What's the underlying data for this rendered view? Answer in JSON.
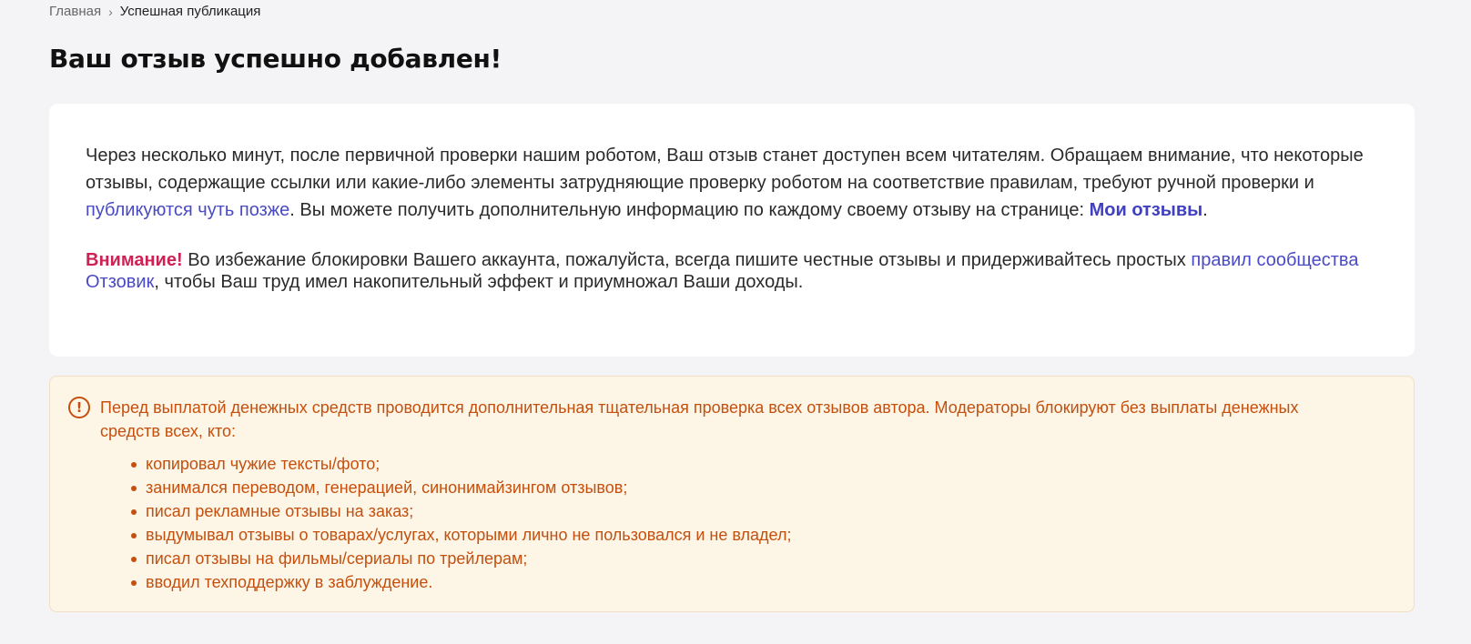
{
  "breadcrumb": {
    "home": "Главная",
    "separator": "›",
    "current": "Успешная публикация"
  },
  "title": "Ваш отзыв успешно добавлен!",
  "intro": {
    "text_before": "Через несколько минут, после первичной проверки нашим роботом, Ваш отзыв станет доступен всем читателям. Обращаем внимание, что некоторые отзывы, содержащие ссылки или какие-либо элементы затрудняющие проверку роботом на соответствие правилам, требуют ручной проверки и ",
    "link_later": "публикуются чуть позже",
    "text_after": ". Вы можете получить дополнительную информацию по каждому своему отзыву на странице: ",
    "link_my_reviews": "Мои отзывы",
    "end": "."
  },
  "warning": {
    "label": "Внимание!",
    "text_before": " Во избежание блокировки Вашего аккаунта, пожалуйста, всегда пишите честные отзывы и придерживайтесь простых ",
    "link_rules": "правил сообщества Отзовик",
    "text_after": ", чтобы Ваш труд имел накопительный эффект и приумножал Ваши доходы."
  },
  "alert": {
    "icon": "exclamation-circle-icon",
    "text": "Перед выплатой денежных средств проводится дополнительная тщательная проверка всех отзывов автора. Модераторы блокируют без выплаты денежных средств всех, кто:",
    "items": [
      "копировал чужие тексты/фото;",
      "занимался переводом, генерацией, синонимайзингом отзывов;",
      "писал рекламные отзывы на заказ;",
      "выдумывал отзывы о товарах/услугах, которыми лично не пользовался и не владел;",
      "писал отзывы на фильмы/сериалы по трейлерам;",
      "вводил техподдержку в заблуждение."
    ]
  },
  "colors": {
    "background": "#f4f4f6",
    "link": "#4a4ac4",
    "attention": "#cc2255",
    "alert_text": "#c4500f",
    "alert_background": "#fdf5e6"
  }
}
